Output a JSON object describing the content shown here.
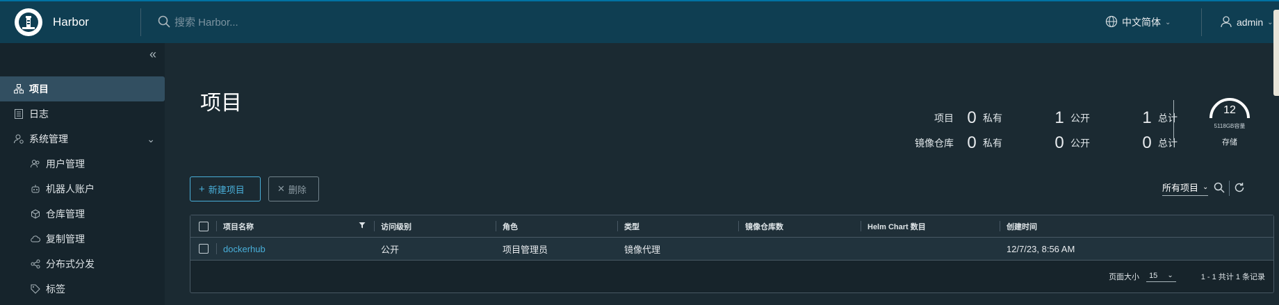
{
  "header": {
    "brand": "Harbor",
    "search_placeholder": "搜索 Harbor...",
    "language": "中文简体",
    "user": "admin"
  },
  "sidebar": {
    "items": [
      {
        "label": "项目"
      },
      {
        "label": "日志"
      },
      {
        "label": "系统管理"
      },
      {
        "label": "用户管理"
      },
      {
        "label": "机器人账户"
      },
      {
        "label": "仓库管理"
      },
      {
        "label": "复制管理"
      },
      {
        "label": "分布式分发"
      },
      {
        "label": "标签"
      }
    ]
  },
  "main": {
    "title": "项目",
    "stats": {
      "projects_label": "项目",
      "repos_label": "镜像仓库",
      "private": "私有",
      "public": "公开",
      "total": "总计",
      "projects": {
        "private": "0",
        "public": "1",
        "total": "1"
      },
      "repos": {
        "private": "0",
        "public": "0",
        "total": "0"
      }
    },
    "storage": {
      "value": "12",
      "capacity": "5118GB容量",
      "label": "存储"
    },
    "buttons": {
      "new_project": "新建项目",
      "delete": "删除"
    },
    "filter": {
      "selected": "所有项目"
    },
    "table": {
      "columns": [
        "项目名称",
        "访问级别",
        "角色",
        "类型",
        "镜像仓库数",
        "Helm Chart 数目",
        "创建时间"
      ],
      "rows": [
        {
          "name": "dockerhub",
          "access": "公开",
          "role": "项目管理员",
          "type": "镜像代理",
          "repo_count": "",
          "chart_count": "",
          "created": "12/7/23, 8:56 AM"
        }
      ],
      "footer": {
        "page_size_label": "页面大小",
        "page_size": "15",
        "summary": "1 - 1 共计 1 条记录"
      }
    }
  },
  "colors": {
    "header": "#0f3e52",
    "accent": "#49afd9",
    "background": "#1b2a32"
  }
}
